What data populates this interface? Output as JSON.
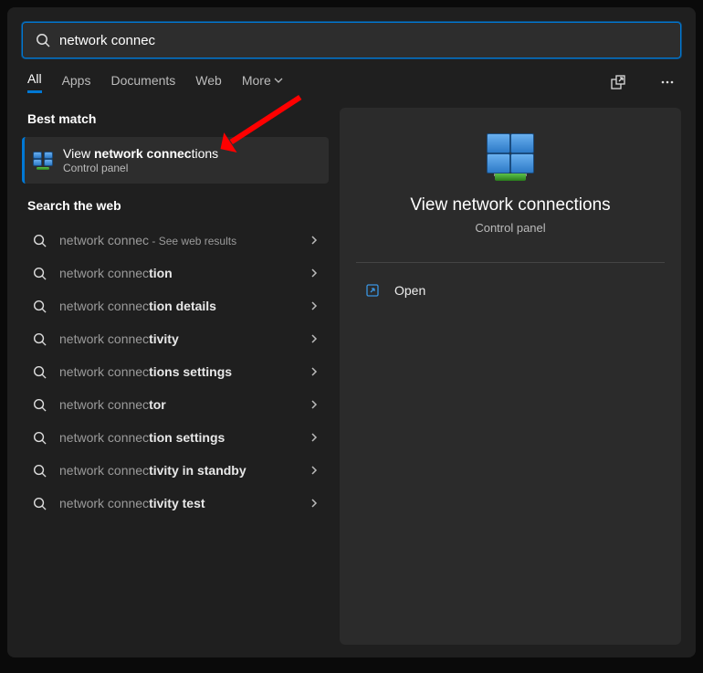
{
  "search": {
    "value": "network connec"
  },
  "tabs": {
    "items": [
      "All",
      "Apps",
      "Documents",
      "Web",
      "More"
    ],
    "active_index": 0
  },
  "sections": {
    "best_match": "Best match",
    "search_web": "Search the web"
  },
  "best_match": {
    "title_pre": "View ",
    "title_bold": "network connec",
    "title_post": "tions",
    "subtitle": "Control panel"
  },
  "web_results": [
    {
      "prefix": "network connec",
      "bold": "",
      "suffix": "",
      "extra": " - See web results"
    },
    {
      "prefix": "network connec",
      "bold": "tion",
      "suffix": "",
      "extra": ""
    },
    {
      "prefix": "network connec",
      "bold": "tion details",
      "suffix": "",
      "extra": ""
    },
    {
      "prefix": "network connec",
      "bold": "tivity",
      "suffix": "",
      "extra": ""
    },
    {
      "prefix": "network connec",
      "bold": "tions settings",
      "suffix": "",
      "extra": ""
    },
    {
      "prefix": "network connec",
      "bold": "tor",
      "suffix": "",
      "extra": ""
    },
    {
      "prefix": "network connec",
      "bold": "tion settings",
      "suffix": "",
      "extra": ""
    },
    {
      "prefix": "network connec",
      "bold": "tivity in standby",
      "suffix": "",
      "extra": ""
    },
    {
      "prefix": "network connec",
      "bold": "tivity test",
      "suffix": "",
      "extra": ""
    }
  ],
  "details": {
    "title": "View network connections",
    "subtitle": "Control panel",
    "actions": {
      "open": "Open"
    }
  }
}
